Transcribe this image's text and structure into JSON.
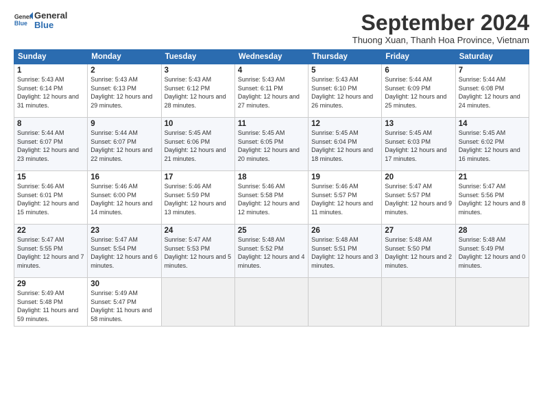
{
  "header": {
    "logo_line1": "General",
    "logo_line2": "Blue",
    "month": "September 2024",
    "location": "Thuong Xuan, Thanh Hoa Province, Vietnam"
  },
  "days_of_week": [
    "Sunday",
    "Monday",
    "Tuesday",
    "Wednesday",
    "Thursday",
    "Friday",
    "Saturday"
  ],
  "weeks": [
    [
      {
        "num": "1",
        "rise": "5:43 AM",
        "set": "6:14 PM",
        "daylight": "12 hours and 31 minutes."
      },
      {
        "num": "2",
        "rise": "5:43 AM",
        "set": "6:13 PM",
        "daylight": "12 hours and 29 minutes."
      },
      {
        "num": "3",
        "rise": "5:43 AM",
        "set": "6:12 PM",
        "daylight": "12 hours and 28 minutes."
      },
      {
        "num": "4",
        "rise": "5:43 AM",
        "set": "6:11 PM",
        "daylight": "12 hours and 27 minutes."
      },
      {
        "num": "5",
        "rise": "5:43 AM",
        "set": "6:10 PM",
        "daylight": "12 hours and 26 minutes."
      },
      {
        "num": "6",
        "rise": "5:44 AM",
        "set": "6:09 PM",
        "daylight": "12 hours and 25 minutes."
      },
      {
        "num": "7",
        "rise": "5:44 AM",
        "set": "6:08 PM",
        "daylight": "12 hours and 24 minutes."
      }
    ],
    [
      {
        "num": "8",
        "rise": "5:44 AM",
        "set": "6:07 PM",
        "daylight": "12 hours and 23 minutes."
      },
      {
        "num": "9",
        "rise": "5:44 AM",
        "set": "6:07 PM",
        "daylight": "12 hours and 22 minutes."
      },
      {
        "num": "10",
        "rise": "5:45 AM",
        "set": "6:06 PM",
        "daylight": "12 hours and 21 minutes."
      },
      {
        "num": "11",
        "rise": "5:45 AM",
        "set": "6:05 PM",
        "daylight": "12 hours and 20 minutes."
      },
      {
        "num": "12",
        "rise": "5:45 AM",
        "set": "6:04 PM",
        "daylight": "12 hours and 18 minutes."
      },
      {
        "num": "13",
        "rise": "5:45 AM",
        "set": "6:03 PM",
        "daylight": "12 hours and 17 minutes."
      },
      {
        "num": "14",
        "rise": "5:45 AM",
        "set": "6:02 PM",
        "daylight": "12 hours and 16 minutes."
      }
    ],
    [
      {
        "num": "15",
        "rise": "5:46 AM",
        "set": "6:01 PM",
        "daylight": "12 hours and 15 minutes."
      },
      {
        "num": "16",
        "rise": "5:46 AM",
        "set": "6:00 PM",
        "daylight": "12 hours and 14 minutes."
      },
      {
        "num": "17",
        "rise": "5:46 AM",
        "set": "5:59 PM",
        "daylight": "12 hours and 13 minutes."
      },
      {
        "num": "18",
        "rise": "5:46 AM",
        "set": "5:58 PM",
        "daylight": "12 hours and 12 minutes."
      },
      {
        "num": "19",
        "rise": "5:46 AM",
        "set": "5:57 PM",
        "daylight": "12 hours and 11 minutes."
      },
      {
        "num": "20",
        "rise": "5:47 AM",
        "set": "5:57 PM",
        "daylight": "12 hours and 9 minutes."
      },
      {
        "num": "21",
        "rise": "5:47 AM",
        "set": "5:56 PM",
        "daylight": "12 hours and 8 minutes."
      }
    ],
    [
      {
        "num": "22",
        "rise": "5:47 AM",
        "set": "5:55 PM",
        "daylight": "12 hours and 7 minutes."
      },
      {
        "num": "23",
        "rise": "5:47 AM",
        "set": "5:54 PM",
        "daylight": "12 hours and 6 minutes."
      },
      {
        "num": "24",
        "rise": "5:47 AM",
        "set": "5:53 PM",
        "daylight": "12 hours and 5 minutes."
      },
      {
        "num": "25",
        "rise": "5:48 AM",
        "set": "5:52 PM",
        "daylight": "12 hours and 4 minutes."
      },
      {
        "num": "26",
        "rise": "5:48 AM",
        "set": "5:51 PM",
        "daylight": "12 hours and 3 minutes."
      },
      {
        "num": "27",
        "rise": "5:48 AM",
        "set": "5:50 PM",
        "daylight": "12 hours and 2 minutes."
      },
      {
        "num": "28",
        "rise": "5:48 AM",
        "set": "5:49 PM",
        "daylight": "12 hours and 0 minutes."
      }
    ],
    [
      {
        "num": "29",
        "rise": "5:49 AM",
        "set": "5:48 PM",
        "daylight": "11 hours and 59 minutes."
      },
      {
        "num": "30",
        "rise": "5:49 AM",
        "set": "5:47 PM",
        "daylight": "11 hours and 58 minutes."
      },
      null,
      null,
      null,
      null,
      null
    ]
  ],
  "labels": {
    "sunrise": "Sunrise:",
    "sunset": "Sunset:",
    "daylight": "Daylight:"
  }
}
